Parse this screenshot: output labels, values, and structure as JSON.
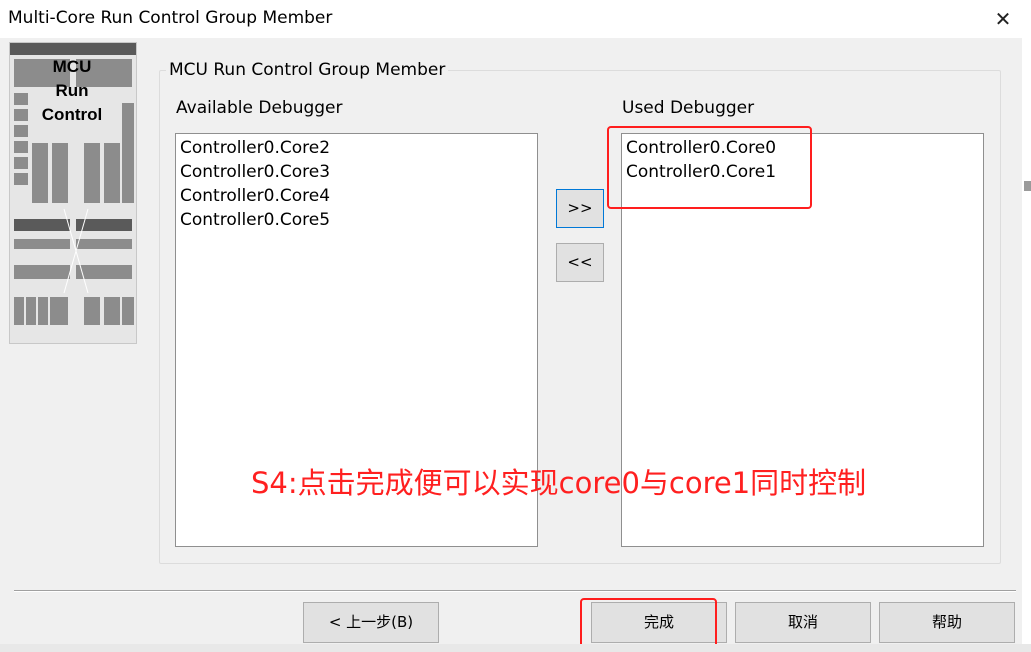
{
  "window": {
    "title": "Multi-Core Run Control Group Member",
    "close_glyph": "✕"
  },
  "thumbnail": {
    "label_lines": [
      "MCU",
      "Run",
      "Control"
    ]
  },
  "group": {
    "legend": "MCU Run Control Group Member"
  },
  "available": {
    "label": "Available Debugger",
    "items": [
      "Controller0.Core2",
      "Controller0.Core3",
      "Controller0.Core4",
      "Controller0.Core5"
    ]
  },
  "used": {
    "label": "Used Debugger",
    "items": [
      "Controller0.Core0",
      "Controller0.Core1"
    ]
  },
  "transfer": {
    "add_label": ">>",
    "remove_label": "<<"
  },
  "footer": {
    "back_label": "< 上一步(B)",
    "finish_label": "完成",
    "cancel_label": "取消",
    "help_label": "帮助"
  },
  "annotation": {
    "text": "S4:点击完成便可以实现core0与core1同时控制",
    "color": "#ff2020"
  },
  "icons": {
    "close": "close-icon"
  }
}
